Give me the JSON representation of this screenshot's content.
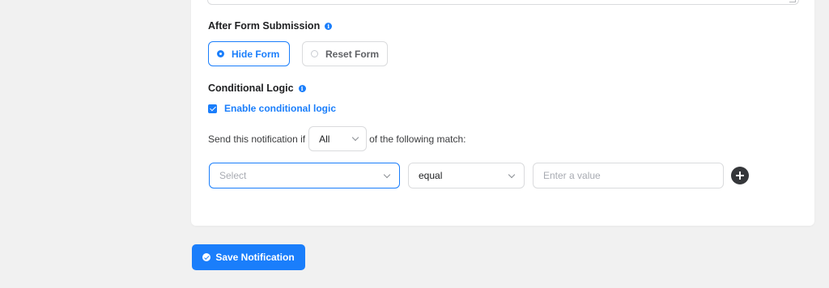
{
  "after_submission": {
    "title": "After Form Submission",
    "options": [
      {
        "label": "Hide Form",
        "selected": true
      },
      {
        "label": "Reset Form",
        "selected": false
      }
    ]
  },
  "conditional_logic": {
    "title": "Conditional Logic",
    "enable_label": "Enable conditional logic",
    "enabled": true,
    "match_prefix": "Send this notification if",
    "match_value": "All",
    "match_suffix": "of the following match:",
    "rule": {
      "field_placeholder": "Select",
      "operator_value": "equal",
      "value_placeholder": "Enter a value"
    }
  },
  "footer": {
    "save_label": "Save Notification"
  },
  "colors": {
    "accent": "#1a7efb",
    "add_button": "#35373a"
  }
}
